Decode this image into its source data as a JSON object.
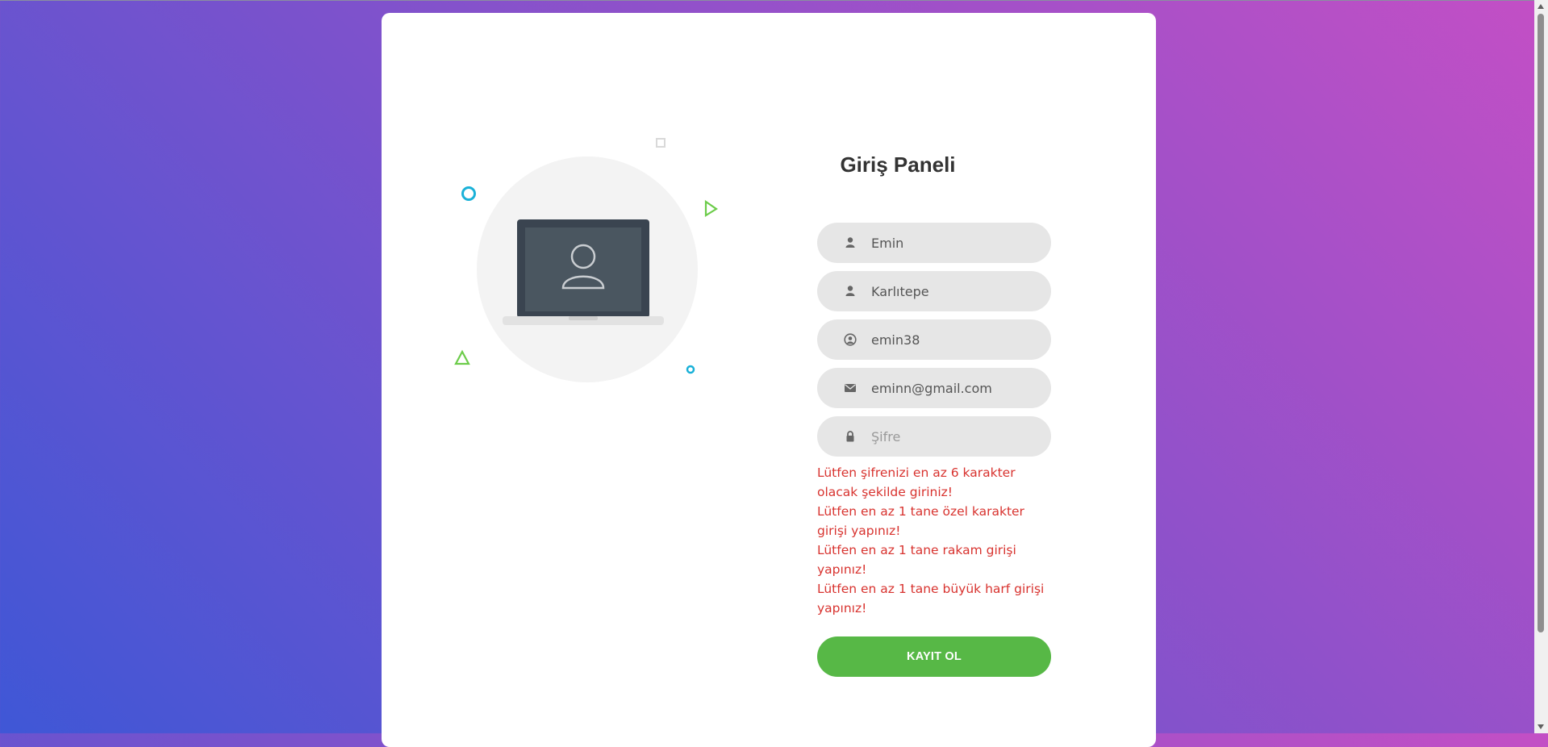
{
  "page": {
    "title": "Giriş Paneli"
  },
  "form": {
    "first_name": {
      "value": "Emin",
      "icon": "user-icon"
    },
    "last_name": {
      "value": "Karlıtepe",
      "icon": "user-icon"
    },
    "username": {
      "value": "emin38",
      "icon": "user-circle-icon"
    },
    "email": {
      "value": "eminn@gmail.com",
      "icon": "envelope-icon"
    },
    "password": {
      "value": "",
      "placeholder": "Şifre",
      "icon": "lock-icon"
    }
  },
  "errors": [
    "Lütfen şifrenizi en az 6 karakter olacak şekilde giriniz!",
    "Lütfen en az 1 tane özel karakter girişi yapınız!",
    "Lütfen en az 1 tane rakam girişi yapınız!",
    "Lütfen en az 1 tane büyük harf girişi yapınız!"
  ],
  "submit": {
    "label": "KAYIT OL"
  },
  "colors": {
    "accent_green": "#57b846",
    "error_red": "#d8332f",
    "field_bg": "#e6e6e6",
    "decor_cyan": "#1ab1d8",
    "decor_green": "#6ccc4a"
  }
}
